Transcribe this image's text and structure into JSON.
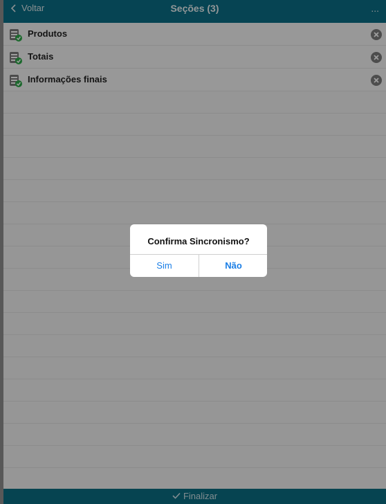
{
  "header": {
    "back_label": "Voltar",
    "title": "Seções (3)",
    "more_label": "..."
  },
  "sections": [
    {
      "label": "Produtos"
    },
    {
      "label": "Totais"
    },
    {
      "label": "Informações finais"
    }
  ],
  "footer": {
    "finalize_label": "Finalizar"
  },
  "dialog": {
    "message": "Confirma Sincronismo?",
    "yes_label": "Sim",
    "no_label": "Não"
  },
  "colors": {
    "header_bg": "#0b6f86",
    "dialog_button": "#1a7ee6",
    "check_badge": "#2eaa4a"
  }
}
